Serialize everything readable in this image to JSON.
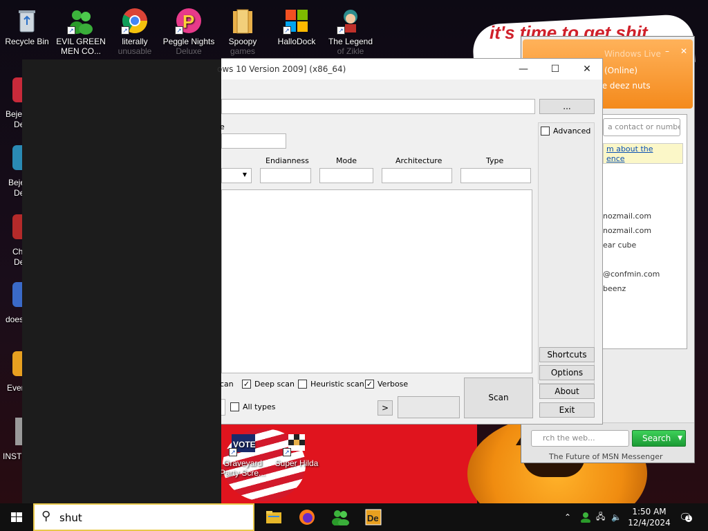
{
  "wallpaper": {
    "banner_text": "it's time to get shit"
  },
  "desktop_icons": [
    {
      "label": "Recycle Bin"
    },
    {
      "label": "EVIL GREEN MEN CO..."
    },
    {
      "label": "literally",
      "label2": "unusable"
    },
    {
      "label": "Peggle Nights",
      "label2": "Deluxe"
    },
    {
      "label": "Spoopy",
      "label2": "games"
    },
    {
      "label": "HalloDock"
    },
    {
      "label": "The Legend",
      "label2": "of Zikle"
    },
    {
      "label": "Graveyard",
      "label2": "Party Scre..."
    },
    {
      "label": "Super Hilda"
    }
  ],
  "side_labels": [
    "Bejec",
    "De",
    "Beje",
    "De",
    "Ch",
    "De",
    "does",
    "Ever",
    "INST"
  ],
  "app": {
    "title": "ows 10 Version 2009] (x86_64)",
    "browse_label": "...",
    "partial_label": "e",
    "advanced_label": "Advanced",
    "columns": [
      "Endianness",
      "Mode",
      "Architecture",
      "Type"
    ],
    "buttons": {
      "shortcuts": "Shortcuts",
      "options": "Options",
      "about": "About",
      "exit": "Exit",
      "scan": "Scan",
      "more": ">"
    },
    "checks": {
      "partial_scan": "can",
      "deep_scan": "Deep scan",
      "heuristic_scan": "Heuristic scan",
      "verbose": "Verbose",
      "all_types": "All types"
    },
    "check_states": {
      "deep_scan": true,
      "heuristic_scan": false,
      "verbose": true,
      "all_types": false,
      "advanced": false
    }
  },
  "msn": {
    "title": "Windows Live",
    "status": "(Online)",
    "personal_msg": "te deez nuts",
    "search_contacts_placeholder": "a contact or numbe",
    "ad_line1": "m about the",
    "ad_line2": "ence",
    "contacts": [
      "nozmail.com",
      "nozmail.com",
      "ear cube",
      "@confmin.com",
      "beenz"
    ],
    "web_search_placeholder": "rch the web...",
    "search_button": "Search",
    "footer": "The Future of MSN Messenger"
  },
  "taskbar": {
    "search_value": "shut",
    "time": "1:50 AM",
    "date": "12/4/2024",
    "notification_count": "1"
  },
  "colors": {
    "accent_orange": "#f48a1c",
    "search_green": "#1b9a34",
    "wallpaper_red": "#e0141e"
  }
}
